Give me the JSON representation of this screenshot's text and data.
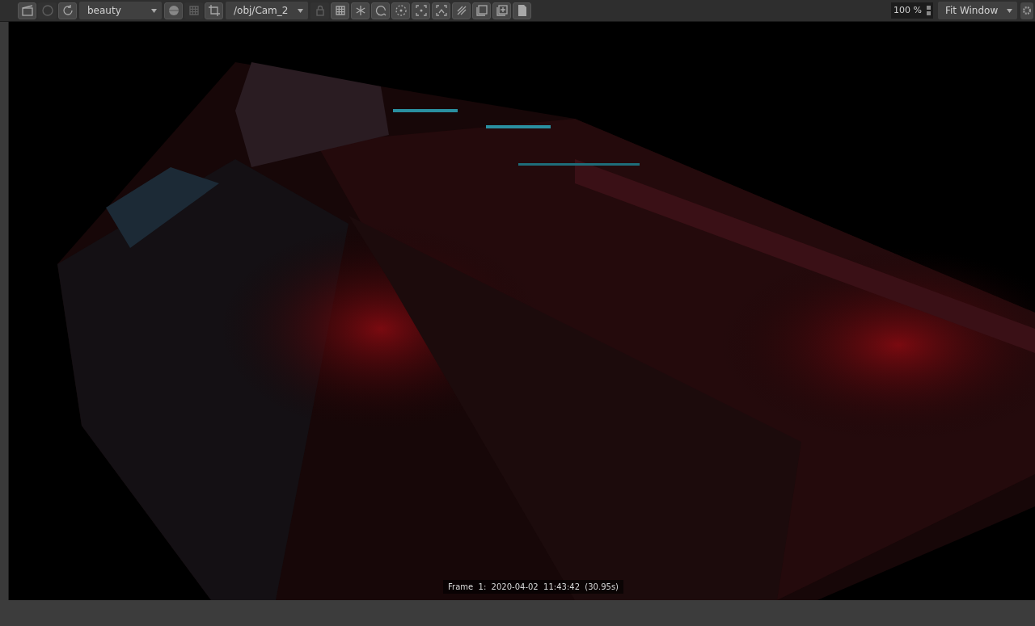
{
  "toolbar": {
    "items": [
      {
        "kind": "button",
        "disabled": false
      },
      {
        "kind": "button",
        "disabled": true
      },
      {
        "kind": "button",
        "disabled": false
      },
      {
        "kind": "dropdown",
        "value": "beauty"
      },
      {
        "kind": "button",
        "disabled": false
      },
      {
        "kind": "button",
        "disabled": true
      },
      {
        "kind": "button",
        "disabled": false
      },
      {
        "kind": "dropdown",
        "value": "/obj/Cam_2"
      },
      {
        "kind": "button",
        "disabled": true
      },
      {
        "kind": "button",
        "disabled": false
      },
      {
        "kind": "button",
        "disabled": false
      },
      {
        "kind": "button",
        "disabled": false
      },
      {
        "kind": "button",
        "disabled": false
      },
      {
        "kind": "button",
        "disabled": false
      },
      {
        "kind": "button",
        "disabled": false
      },
      {
        "kind": "button",
        "disabled": false
      },
      {
        "kind": "button",
        "disabled": false
      },
      {
        "kind": "button",
        "disabled": false
      },
      {
        "kind": "button",
        "disabled": false
      }
    ],
    "zoom": "100 %",
    "fit": "Fit Window"
  },
  "viewport": {
    "kind": "picture",
    "frame_info": "Frame  1:  2020-04-02  11:43:42  (30.95s)"
  }
}
